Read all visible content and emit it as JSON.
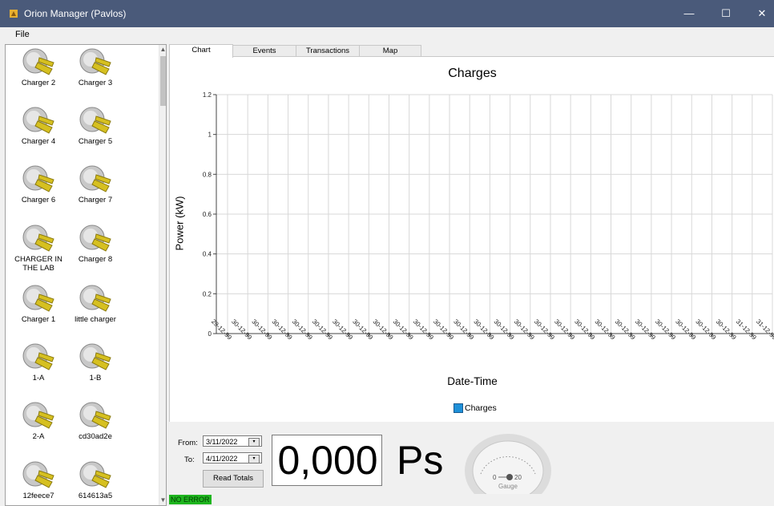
{
  "window": {
    "title": "Orion Manager (Pavlos)",
    "min_glyph": "—",
    "max_glyph": "☐",
    "close_glyph": "✕"
  },
  "menu": {
    "file": "File"
  },
  "chargers": [
    "Charger 2",
    "Charger 3",
    "Charger 4",
    "Charger 5",
    "Charger 6",
    "Charger 7",
    "CHARGER IN THE LAB",
    "Charger 8",
    "Charger 1",
    "little charger",
    "1-A",
    "1-B",
    "2-A",
    "cd30ad2e",
    "12feece7",
    "614613a5"
  ],
  "tabs": [
    "Chart",
    "Events",
    "Transactions",
    "Map"
  ],
  "chart_data": {
    "type": "line",
    "title": "Charges",
    "xlabel": "Date-Time",
    "ylabel": "Power (kW)",
    "ylim": [
      0,
      1.2
    ],
    "y_ticks": [
      "0",
      "0.2",
      "0.4",
      "0.6",
      "0.8",
      "1",
      "1.2"
    ],
    "x_ticks": [
      "29-12-99",
      "30-12-99",
      "30-12-99",
      "30-12-99",
      "30-12-99",
      "30-12-99",
      "30-12-99",
      "30-12-99",
      "30-12-99",
      "30-12-99",
      "30-12-99",
      "30-12-99",
      "30-12-99",
      "30-12-99",
      "30-12-99",
      "30-12-99",
      "30-12-99",
      "30-12-99",
      "30-12-99",
      "30-12-99",
      "30-12-99",
      "30-12-99",
      "30-12-99",
      "30-12-99",
      "30-12-99",
      "30-12-99",
      "31-12-99",
      "31-12-99"
    ],
    "series": [
      {
        "name": "Charges",
        "values": [],
        "color": "#1e90d8"
      }
    ],
    "grid": true,
    "legend": "bottom-center"
  },
  "totals": {
    "from_label": "From:",
    "to_label": "To:",
    "from_date": "3/11/2022",
    "to_date": "4/11/2022",
    "read_button": "Read Totals",
    "value": "0,000",
    "units": "Ps"
  },
  "gauge": {
    "label": "Gauge",
    "min": "0",
    "max": "20"
  },
  "status": {
    "text": "NO ERROR",
    "color": "#1fb51f"
  }
}
